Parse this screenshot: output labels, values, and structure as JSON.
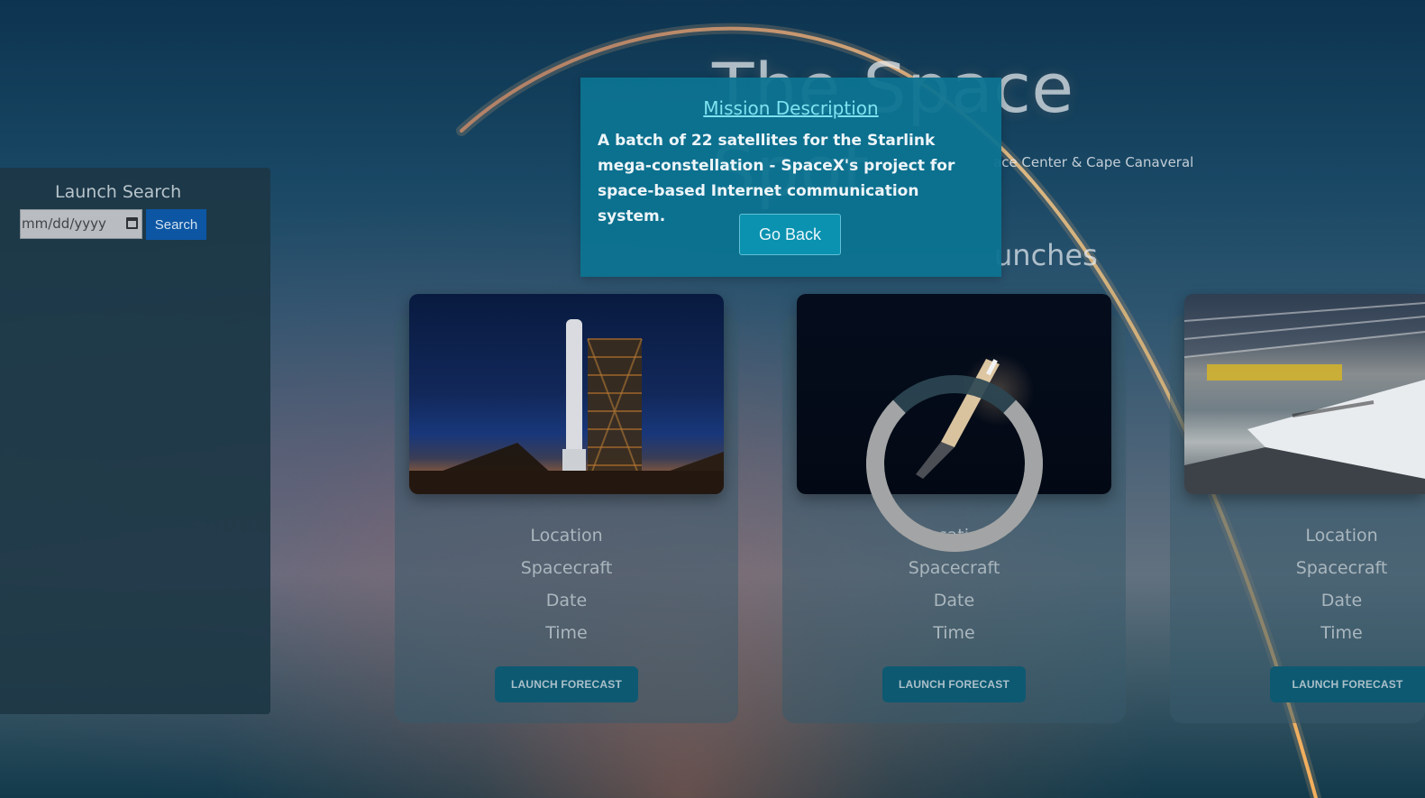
{
  "hero": {
    "title": "The Space Spot",
    "subtitle": "ace Center & Cape Canaveral"
  },
  "section": {
    "title": "unches"
  },
  "search_panel": {
    "title": "Launch Search",
    "date_placeholder": "mm/dd/yyyy",
    "search_label": "Search"
  },
  "cards": [
    {
      "location_label": "Location",
      "spacecraft_label": "Spacecraft",
      "date_label": "Date",
      "time_label": "Time",
      "forecast_label": "LAUNCH FORECAST",
      "image_icon": "rocket-launchpad-image"
    },
    {
      "location_label": "Location",
      "spacecraft_label": "Spacecraft",
      "date_label": "Date",
      "time_label": "Time",
      "forecast_label": "LAUNCH FORECAST",
      "image_icon": "rocket-night-launch-image"
    },
    {
      "location_label": "Location",
      "spacecraft_label": "Spacecraft",
      "date_label": "Date",
      "time_label": "Time",
      "forecast_label": "LAUNCH FORECAST",
      "image_icon": "spacecraft-hangar-image"
    }
  ],
  "modal": {
    "title": "Mission Description",
    "description": "A batch of 22 satellites for the Starlink mega-constellation - SpaceX's project for space-based Internet communication system.",
    "go_back_label": "Go Back"
  },
  "icons": {
    "calendar": "calendar-icon",
    "loading": "loading-spinner-icon"
  }
}
